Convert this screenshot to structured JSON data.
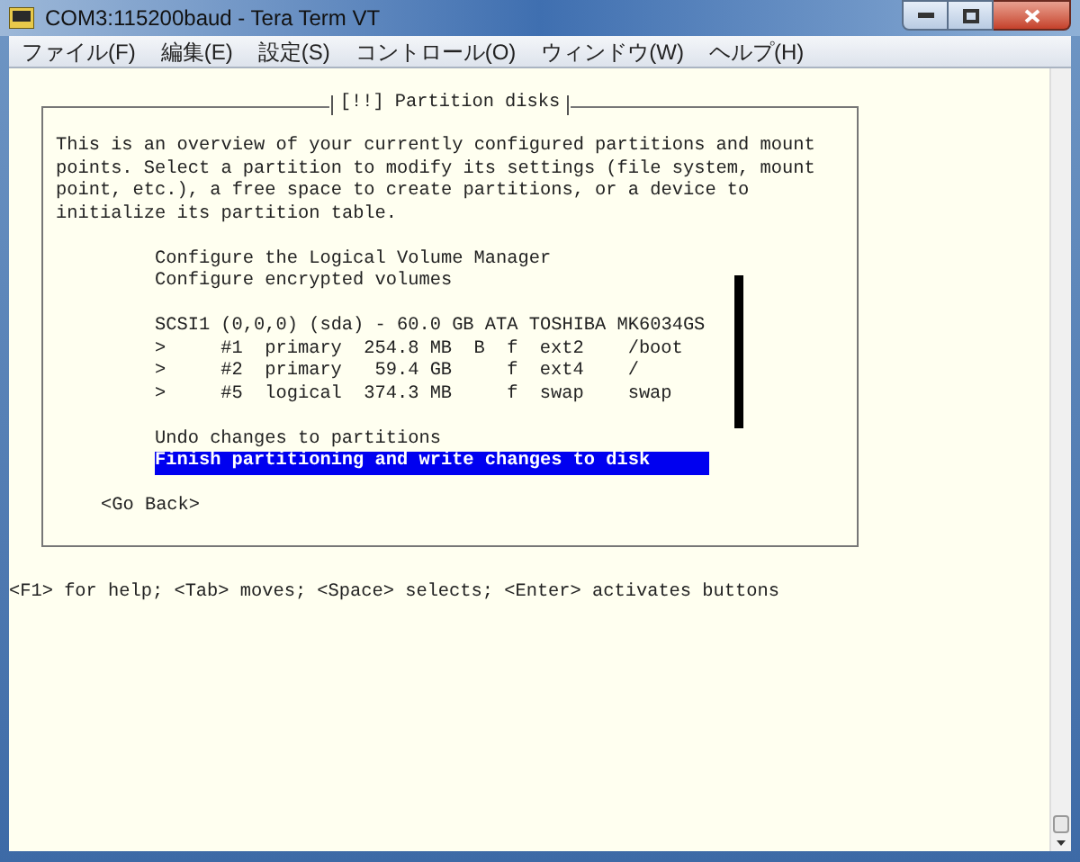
{
  "window": {
    "title": "COM3:115200baud - Tera Term VT"
  },
  "menu": [
    {
      "label": "ファイル(F)"
    },
    {
      "label": "編集(E)"
    },
    {
      "label": "設定(S)"
    },
    {
      "label": "コントロール(O)"
    },
    {
      "label": "ウィンドウ(W)"
    },
    {
      "label": "ヘルプ(H)"
    }
  ],
  "dialog": {
    "title": "[!!] Partition disks",
    "description": "This is an overview of your currently configured partitions and mount points. Select a partition to modify its settings (file system, mount point, etc.), a free space to create partitions, or a device to initialize its partition table.",
    "groups": [
      [
        {
          "kind": "action",
          "label": "Configure the Logical Volume Manager",
          "selected": false
        },
        {
          "kind": "action",
          "label": "Configure encrypted volumes",
          "selected": false
        }
      ],
      [
        {
          "kind": "disk",
          "label": "SCSI1 (0,0,0) (sda) - 60.0 GB ATA TOSHIBA MK6034GS",
          "selected": false
        },
        {
          "kind": "partition",
          "marker": ">",
          "number": "#1",
          "type": "primary",
          "size": "254.8 MB",
          "boot_flag": "B",
          "format_flag": "f",
          "filesystem": "ext2",
          "mount": "/boot",
          "selected": false
        },
        {
          "kind": "partition",
          "marker": ">",
          "number": "#2",
          "type": "primary",
          "size": "59.4 GB",
          "format_flag": "f",
          "filesystem": "ext4",
          "mount": "/",
          "selected": false
        },
        {
          "kind": "partition",
          "marker": ">",
          "number": "#5",
          "type": "logical",
          "size": "374.3 MB",
          "format_flag": "f",
          "filesystem": "swap",
          "mount": "swap",
          "selected": false
        }
      ],
      [
        {
          "kind": "action",
          "label": "Undo changes to partitions",
          "selected": false
        },
        {
          "kind": "action",
          "label": "Finish partitioning and write changes to disk",
          "selected": true
        }
      ]
    ],
    "back_button": "<Go Back>"
  },
  "help_line": "<F1> for help; <Tab> moves; <Space> selects; <Enter> activates buttons"
}
